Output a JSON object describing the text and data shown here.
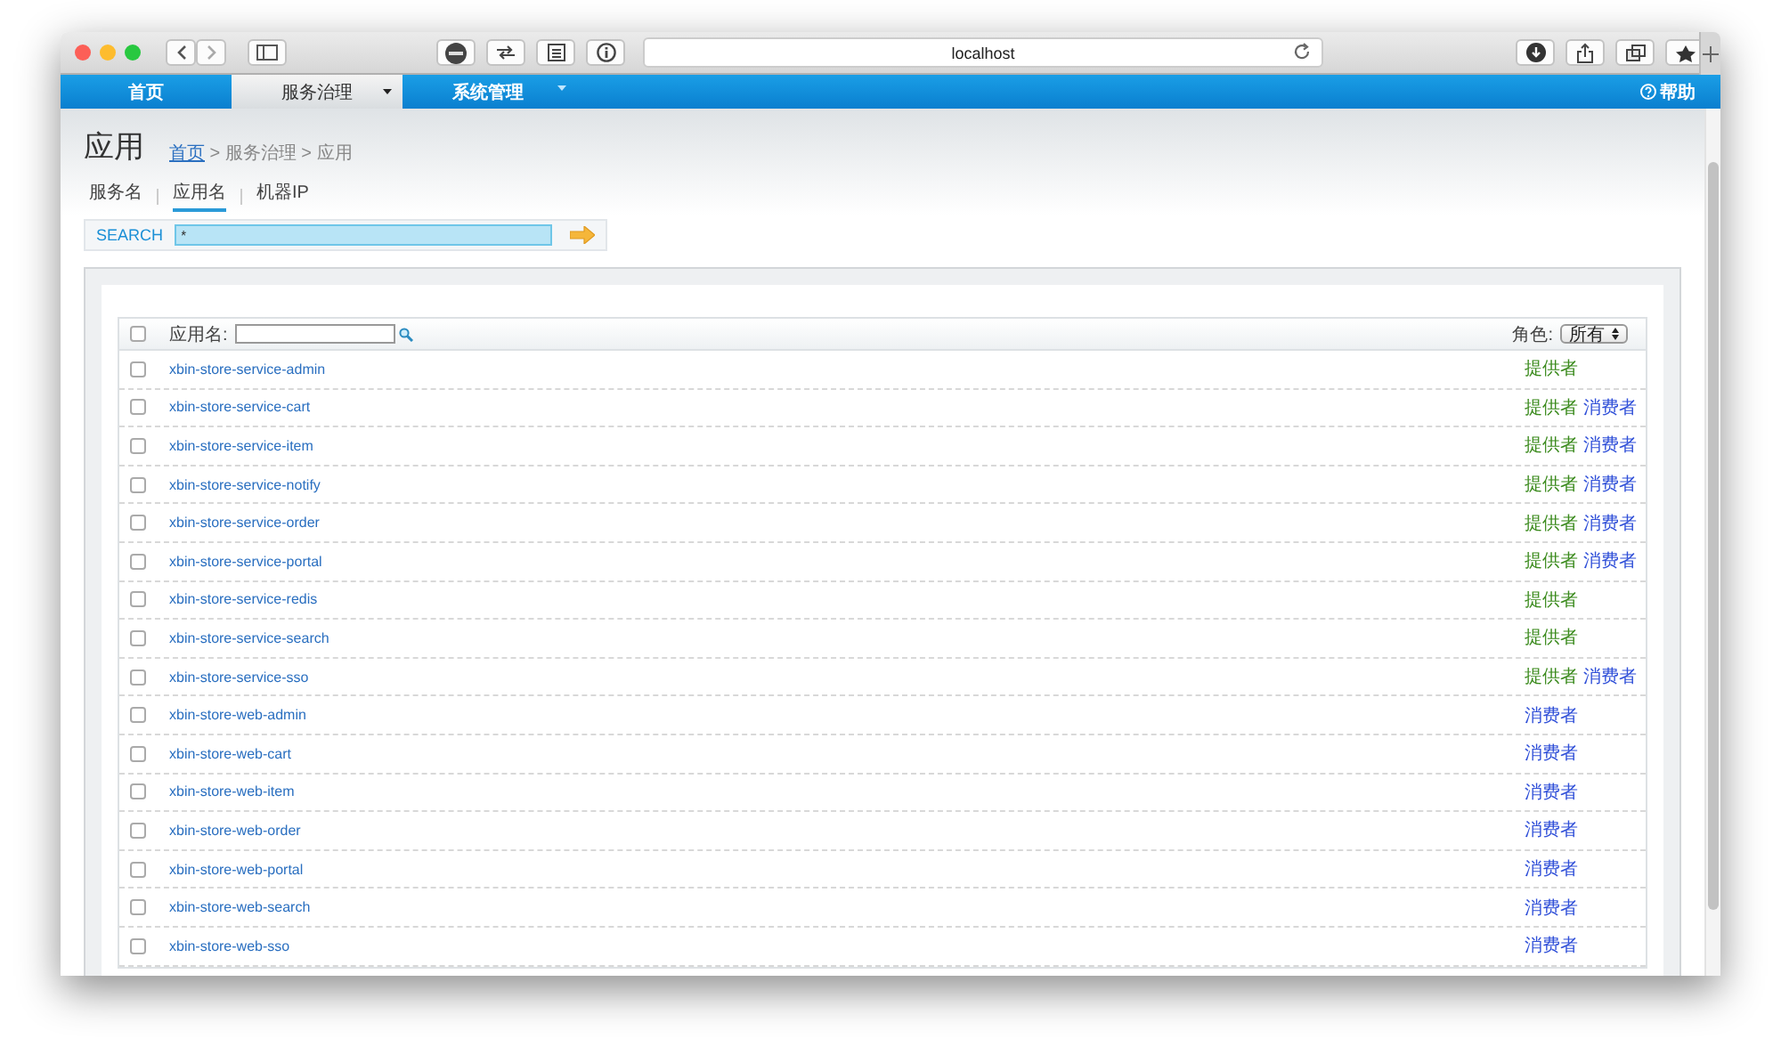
{
  "browser": {
    "url": "localhost"
  },
  "nav": {
    "items": [
      {
        "label": "首页",
        "selected": false,
        "dropdown": false
      },
      {
        "label": "服务治理",
        "selected": true,
        "dropdown": true
      },
      {
        "label": "系统管理",
        "selected": false,
        "dropdown": true
      }
    ],
    "help": "帮助"
  },
  "page": {
    "title": "应用",
    "breadcrumb": [
      {
        "label": "首页",
        "link": true
      },
      {
        "label": " > 服务治理 > 应用",
        "link": false
      }
    ]
  },
  "tabs": [
    {
      "label": "服务名",
      "selected": false
    },
    {
      "label": "应用名",
      "selected": true
    },
    {
      "label": "机器IP",
      "selected": false
    }
  ],
  "search": {
    "label": "SEARCH",
    "value": "*"
  },
  "table": {
    "select_all_checked": false,
    "filter_label": "应用名:",
    "role_label": "角色:",
    "role_value": "所有",
    "rows": [
      {
        "name": "xbin-store-service-admin",
        "checked": false,
        "roles": [
          {
            "kind": "provider",
            "label": "提供者"
          }
        ]
      },
      {
        "name": "xbin-store-service-cart",
        "checked": false,
        "roles": [
          {
            "kind": "provider",
            "label": "提供者"
          },
          {
            "kind": "consumer",
            "label": "消费者"
          }
        ]
      },
      {
        "name": "xbin-store-service-item",
        "checked": false,
        "roles": [
          {
            "kind": "provider",
            "label": "提供者"
          },
          {
            "kind": "consumer",
            "label": "消费者"
          }
        ]
      },
      {
        "name": "xbin-store-service-notify",
        "checked": false,
        "roles": [
          {
            "kind": "provider",
            "label": "提供者"
          },
          {
            "kind": "consumer",
            "label": "消费者"
          }
        ]
      },
      {
        "name": "xbin-store-service-order",
        "checked": false,
        "roles": [
          {
            "kind": "provider",
            "label": "提供者"
          },
          {
            "kind": "consumer",
            "label": "消费者"
          }
        ]
      },
      {
        "name": "xbin-store-service-portal",
        "checked": false,
        "roles": [
          {
            "kind": "provider",
            "label": "提供者"
          },
          {
            "kind": "consumer",
            "label": "消费者"
          }
        ]
      },
      {
        "name": "xbin-store-service-redis",
        "checked": false,
        "roles": [
          {
            "kind": "provider",
            "label": "提供者"
          }
        ]
      },
      {
        "name": "xbin-store-service-search",
        "checked": false,
        "roles": [
          {
            "kind": "provider",
            "label": "提供者"
          }
        ]
      },
      {
        "name": "xbin-store-service-sso",
        "checked": false,
        "roles": [
          {
            "kind": "provider",
            "label": "提供者"
          },
          {
            "kind": "consumer",
            "label": "消费者"
          }
        ]
      },
      {
        "name": "xbin-store-web-admin",
        "checked": false,
        "roles": [
          {
            "kind": "consumer",
            "label": "消费者"
          }
        ]
      },
      {
        "name": "xbin-store-web-cart",
        "checked": false,
        "roles": [
          {
            "kind": "consumer",
            "label": "消费者"
          }
        ]
      },
      {
        "name": "xbin-store-web-item",
        "checked": false,
        "roles": [
          {
            "kind": "consumer",
            "label": "消费者"
          }
        ]
      },
      {
        "name": "xbin-store-web-order",
        "checked": false,
        "roles": [
          {
            "kind": "consumer",
            "label": "消费者"
          }
        ]
      },
      {
        "name": "xbin-store-web-portal",
        "checked": false,
        "roles": [
          {
            "kind": "consumer",
            "label": "消费者"
          }
        ]
      },
      {
        "name": "xbin-store-web-search",
        "checked": false,
        "roles": [
          {
            "kind": "consumer",
            "label": "消费者"
          }
        ]
      },
      {
        "name": "xbin-store-web-sso",
        "checked": false,
        "roles": [
          {
            "kind": "consumer",
            "label": "消费者"
          }
        ]
      }
    ]
  }
}
